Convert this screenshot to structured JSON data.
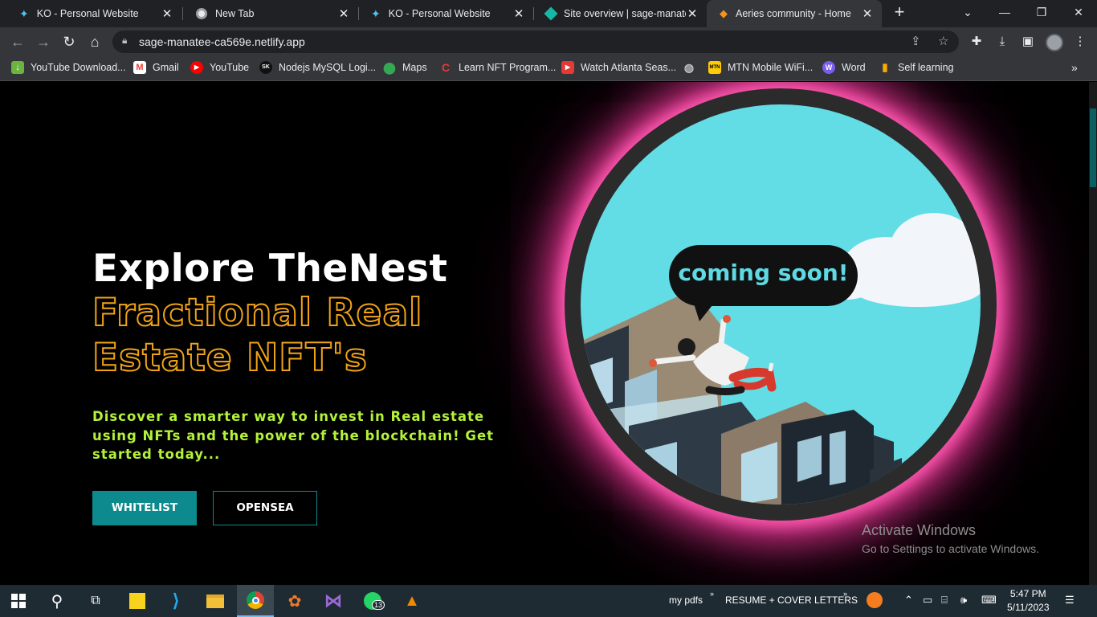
{
  "browser": {
    "tabs": [
      {
        "title": "KO - Personal Website",
        "icon": "ko-site-icon"
      },
      {
        "title": "New Tab",
        "icon": "chrome-icon"
      },
      {
        "title": "KO - Personal Website",
        "icon": "ko-site-icon"
      },
      {
        "title": "Site overview | sage-manatee",
        "icon": "netlify-icon"
      },
      {
        "title": "Aeries community - Home",
        "icon": "ethereum-icon",
        "active": true
      }
    ],
    "url": "sage-manatee-ca569e.netlify.app",
    "bookmarks": [
      {
        "label": "YouTube Download...",
        "icon": "download-icon"
      },
      {
        "label": "Gmail",
        "icon": "gmail-icon"
      },
      {
        "label": "YouTube",
        "icon": "youtube-icon"
      },
      {
        "label": "Nodejs MySQL Logi...",
        "icon": "sk-icon"
      },
      {
        "label": "Maps",
        "icon": "maps-icon"
      },
      {
        "label": "Learn NFT Program...",
        "icon": "c-icon"
      },
      {
        "label": "Watch Atlanta Seas...",
        "icon": "play-icon"
      },
      {
        "label": "",
        "icon": "globe-icon"
      },
      {
        "label": "MTN Mobile WiFi...",
        "icon": "mtn-icon"
      },
      {
        "label": "Word",
        "icon": "word-icon"
      },
      {
        "label": "Self learning",
        "icon": "bars-icon"
      }
    ]
  },
  "hero": {
    "title": "Explore TheNest",
    "subtitle_line1": "Fractional Real",
    "subtitle_line2": "Estate NFT's",
    "description": "Discover a smarter way to invest in Real estate using NFTs and the power of the blockchain! Get started today...",
    "buttons": {
      "whitelist": "WHITELIST",
      "opensea": "OPENSEA"
    },
    "image_caption": "coming soon!"
  },
  "overlay": {
    "activate_title": "Activate Windows",
    "activate_sub": "Go to Settings to activate Windows."
  },
  "taskbar": {
    "whatsapp_badge": "13",
    "folder1": "my pdfs",
    "folder2": "RESUME + COVER LETTERS",
    "time": "5:47 PM",
    "date": "5/11/2023"
  },
  "colors": {
    "accent_teal": "#0d8a8d",
    "title_orange": "#f0a318",
    "desc_green": "#b4f23a",
    "glow_pink": "#ff5bb0",
    "sky": "#62dde6"
  }
}
